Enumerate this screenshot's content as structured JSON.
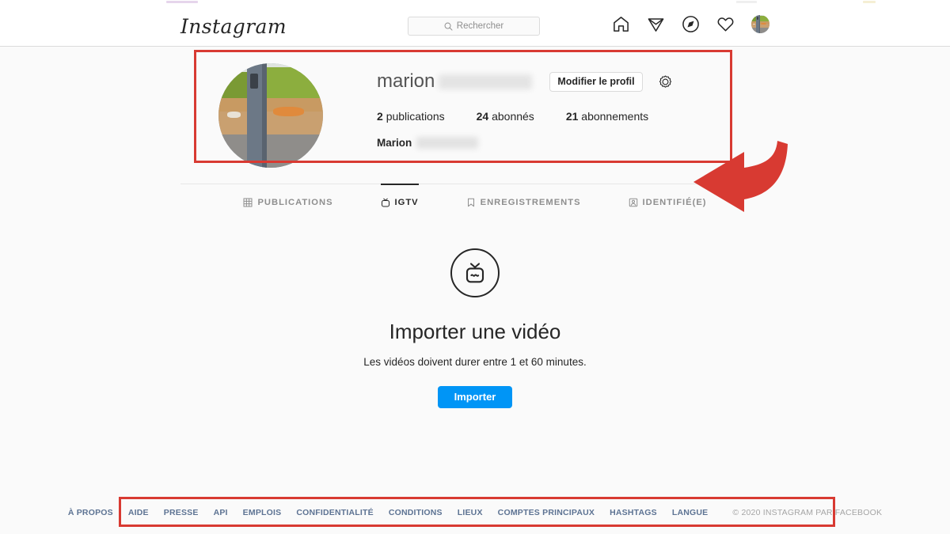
{
  "app": {
    "name": "Instagram",
    "logo_text": "Instagram"
  },
  "topbar": {
    "search": {
      "placeholder": "Rechercher",
      "value": "",
      "icon": "search-icon"
    },
    "icons": [
      {
        "name": "home-icon",
        "label": "Accueil"
      },
      {
        "name": "send-icon",
        "label": "Messages"
      },
      {
        "name": "compass-icon",
        "label": "Explorer"
      },
      {
        "name": "heart-icon",
        "label": "Notifications"
      }
    ],
    "avatar": {
      "name": "profile-avatar",
      "label": "Profil"
    }
  },
  "profile": {
    "username": "marion",
    "username_redacted": true,
    "edit_button": "Modifier le profil",
    "settings_icon": "gear-icon",
    "stats": [
      {
        "count": "2",
        "label": "publications"
      },
      {
        "count": "24",
        "label": "abonnés"
      },
      {
        "count": "21",
        "label": "abonnements"
      }
    ],
    "full_name": "Marion",
    "full_name_redacted": true
  },
  "tabs": [
    {
      "label": "PUBLICATIONS",
      "icon": "grid-icon",
      "active": false
    },
    {
      "label": "IGTV",
      "icon": "igtv-icon",
      "active": true
    },
    {
      "label": "ENREGISTREMENTS",
      "icon": "bookmark-icon",
      "active": false
    },
    {
      "label": "IDENTIFIÉ(E)",
      "icon": "tagged-icon",
      "active": false
    }
  ],
  "igtv_empty": {
    "icon": "igtv-tv-icon",
    "title": "Importer une vidéo",
    "subtitle": "Les vidéos doivent durer entre 1 et 60 minutes.",
    "button": "Importer"
  },
  "footer": {
    "links": [
      "À PROPOS",
      "AIDE",
      "PRESSE",
      "API",
      "EMPLOIS",
      "CONFIDENTIALITÉ",
      "CONDITIONS",
      "LIEUX",
      "COMPTES PRINCIPAUX",
      "HASHTAGS",
      "LANGUE"
    ],
    "copyright": "© 2020 INSTAGRAM PAR FACEBOOK"
  },
  "annotations": {
    "color": "#d83a32",
    "boxes": [
      {
        "name": "profile-header-highlight"
      },
      {
        "name": "footer-highlight"
      }
    ],
    "arrow": {
      "name": "pointer-arrow",
      "direction": "left",
      "target": "tab-bar"
    }
  }
}
